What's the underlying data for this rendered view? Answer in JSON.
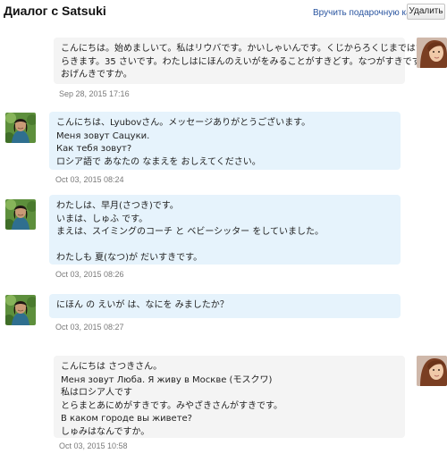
{
  "header": {
    "title": "Диалог с Satsuki",
    "gift_link": "Вручить подарочную карту",
    "delete_button": "Удалить"
  },
  "messages": [
    {
      "sender": "me",
      "lines": [
        "こんにちは。始めましいて。私はリウバです。かいしゃいんです。くじからろくじまではた",
        "らきます。35 さいです。わたしはにほんのえいがをみることがすきどす。なつがすきです。",
        "おげんきですか。"
      ],
      "time": "Sep 28, 2015 17:16"
    },
    {
      "sender": "satsuki",
      "lines": [
        "こんにちは、Lyubovさん。メッセージありがとうございます。",
        "Меня зовут Сацуки.",
        "Как тебя зовут?",
        "ロシア語で あなたの なまえを おしえてください。"
      ],
      "time": "Oct 03, 2015 08:24"
    },
    {
      "sender": "satsuki",
      "lines": [
        "わたしは、早月(さつき)です。",
        "いまは、しゅふ です。",
        "まえは、スイミングのコーチ と ベビーシッター をしていました。",
        "",
        "わたしも 夏(なつ)が だいすきです。"
      ],
      "time": "Oct 03, 2015 08:26"
    },
    {
      "sender": "satsuki",
      "lines": [
        "にほん の えいが は、なにを みましたか？"
      ],
      "time": "Oct 03, 2015 08:27"
    },
    {
      "sender": "me",
      "lines": [
        "こんにちは さつきさん。",
        "Меня зовут Люба. Я живу в Москве (モスクワ)",
        "私はロシア人です",
        "とらまとあにめがすきです。みやざきさんがすきです。",
        "В каком городе вы живете?",
        "しゅみはなんですか。"
      ],
      "time": "Oct 03, 2015 10:58"
    }
  ],
  "icons": {
    "my_avatar": "avatar-photo-icon",
    "satsuki_avatar": "avatar-photo-icon"
  },
  "colors": {
    "my_bubble": "#f4f4f4",
    "their_bubble": "#e6f3fc",
    "link": "#2a55a0",
    "timestamp": "#7a7a7a"
  }
}
